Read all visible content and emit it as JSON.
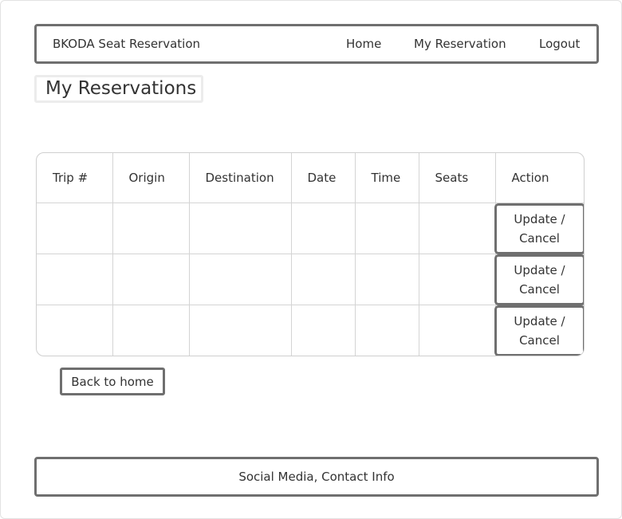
{
  "navbar": {
    "brand": "BKODA Seat Reservation",
    "links": [
      "Home",
      "My Reservation",
      "Logout"
    ]
  },
  "page_title": "My Reservations",
  "table": {
    "headers": [
      "Trip #",
      "Origin",
      "Destination",
      "Date",
      "Time",
      "Seats",
      "Action"
    ],
    "rows": [
      {
        "action_label": "Update /\nCancel"
      },
      {
        "action_label": "Update /\nCancel"
      },
      {
        "action_label": "Update /\nCancel"
      }
    ]
  },
  "back_button": "Back to home",
  "footer": "Social Media, Contact Info"
}
